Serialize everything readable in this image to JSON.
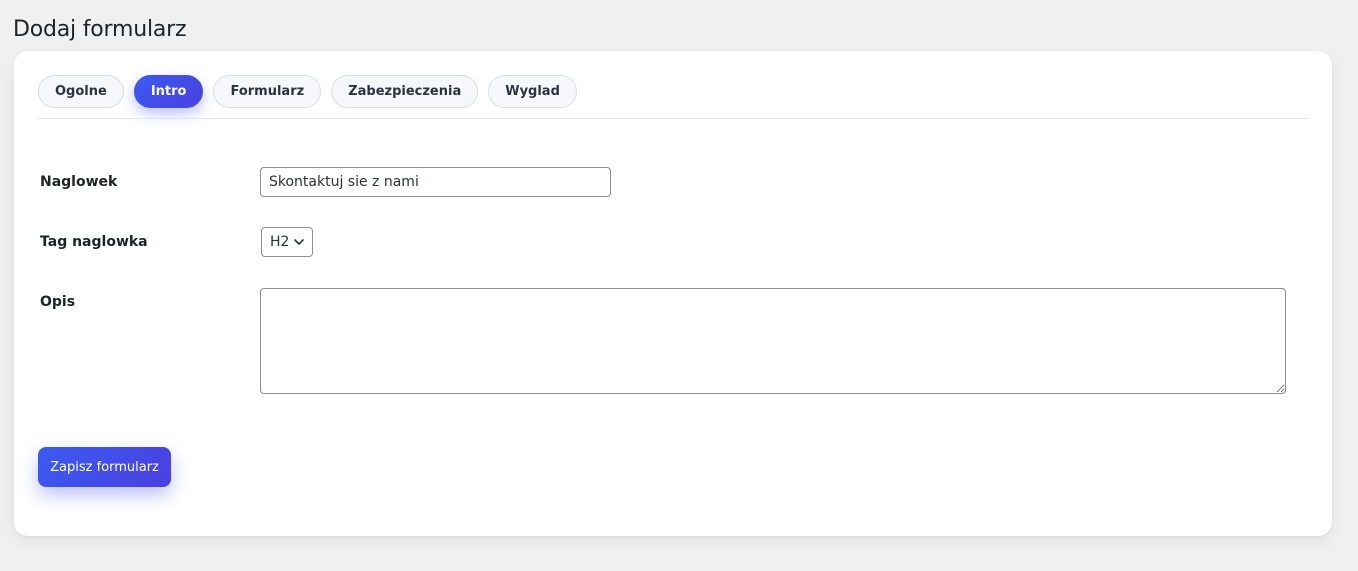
{
  "page": {
    "title": "Dodaj formularz"
  },
  "tabs": [
    {
      "label": "Ogolne",
      "active": false
    },
    {
      "label": "Intro",
      "active": true
    },
    {
      "label": "Formularz",
      "active": false
    },
    {
      "label": "Zabezpieczenia",
      "active": false
    },
    {
      "label": "Wyglad",
      "active": false
    }
  ],
  "form": {
    "heading_label": "Naglowek",
    "heading_value": "Skontaktuj sie z nami",
    "tag_label": "Tag naglowka",
    "tag_value": "H2",
    "description_label": "Opis",
    "description_value": ""
  },
  "actions": {
    "save_label": "Zapisz formularz"
  },
  "colors": {
    "accent": "#3d52ec",
    "accent_gradient_end": "#4a3fe0",
    "background": "#f0f0f1",
    "card": "#ffffff"
  },
  "icons": {
    "select_chevron": "chevron-down-icon"
  }
}
